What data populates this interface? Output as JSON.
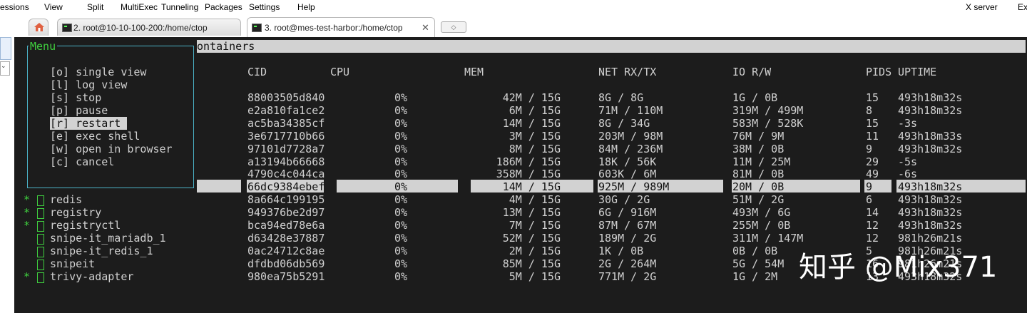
{
  "menubar": {
    "items": [
      "essions",
      "View",
      "Split",
      "MultiExec",
      "Tunneling",
      "Packages",
      "Settings",
      "Help"
    ],
    "right": [
      "X server",
      "Exi"
    ]
  },
  "tabs": [
    {
      "label": "2. root@10-10-100-200:/home/ctop",
      "active": false
    },
    {
      "label": "3. root@mes-test-harbor:/home/ctop",
      "active": true
    }
  ],
  "terminal": {
    "header_bar": "ontainers",
    "columns": [
      "CID",
      "CPU",
      "MEM",
      "NET RX/TX",
      "IO R/W",
      "PIDS",
      "UPTIME"
    ],
    "menu": {
      "title": "Menu",
      "items": [
        "[o] single view",
        "[l] log view",
        "[s] stop",
        "[p] pause",
        "restart",
        "[e] exec shell",
        "[w] open in browser",
        "[c] cancel"
      ],
      "selected_key": "[r]"
    },
    "rows": [
      {
        "name": "",
        "star": false,
        "cid": "88003505d840",
        "cpu": "0%",
        "mem": "42M / 15G",
        "net": "8G / 8G",
        "io": "1G / 0B",
        "pids": "15",
        "uptime": "493h18m32s"
      },
      {
        "name": "",
        "star": false,
        "cid": "e2a810fa1ce2",
        "cpu": "0%",
        "mem": "6M / 15G",
        "net": "71M / 110M",
        "io": "319M / 499M",
        "pids": "8",
        "uptime": "493h18m32s"
      },
      {
        "name": "",
        "star": false,
        "cid": "ac5ba34385cf",
        "cpu": "0%",
        "mem": "14M / 15G",
        "net": "8G / 34G",
        "io": "583M / 528K",
        "pids": "15",
        "uptime": "-3s"
      },
      {
        "name": "",
        "star": false,
        "cid": "3e6717710b66",
        "cpu": "0%",
        "mem": "3M / 15G",
        "net": "203M / 98M",
        "io": "76M / 9M",
        "pids": "11",
        "uptime": "493h18m33s"
      },
      {
        "name": "",
        "star": false,
        "cid": "97101d7728a7",
        "cpu": "0%",
        "mem": "8M / 15G",
        "net": "84M / 236M",
        "io": "38M / 0B",
        "pids": "9",
        "uptime": "493h18m32s"
      },
      {
        "name": "",
        "star": false,
        "cid": "a13194b66668",
        "cpu": "0%",
        "mem": "186M / 15G",
        "net": "18K / 56K",
        "io": "11M / 25M",
        "pids": "29",
        "uptime": "-5s"
      },
      {
        "name": "",
        "star": false,
        "cid": "4790c4c044ca",
        "cpu": "0%",
        "mem": "358M / 15G",
        "net": "603K / 6M",
        "io": "81M / 0B",
        "pids": "49",
        "uptime": "-6s"
      },
      {
        "name": "",
        "star": false,
        "cid": "66dc9384ebef",
        "cpu": "0%",
        "mem": "14M / 15G",
        "net": "925M / 989M",
        "io": "20M / 0B",
        "pids": "9",
        "uptime": "493h18m32s",
        "selected": true
      },
      {
        "name": "redis",
        "star": true,
        "cid": "8a664c199195",
        "cpu": "0%",
        "mem": "4M / 15G",
        "net": "30G / 2G",
        "io": "51M / 2G",
        "pids": "6",
        "uptime": "493h18m32s"
      },
      {
        "name": "registry",
        "star": true,
        "cid": "949376be2d97",
        "cpu": "0%",
        "mem": "13M / 15G",
        "net": "6G / 916M",
        "io": "493M / 6G",
        "pids": "14",
        "uptime": "493h18m32s"
      },
      {
        "name": "registryctl",
        "star": true,
        "cid": "bca94ed78e6a",
        "cpu": "0%",
        "mem": "7M / 15G",
        "net": "87M / 67M",
        "io": "255M / 0B",
        "pids": "12",
        "uptime": "493h18m32s"
      },
      {
        "name": "snipe-it_mariadb_1",
        "star": false,
        "cid": "d63428e37887",
        "cpu": "0%",
        "mem": "52M / 15G",
        "net": "189M / 2G",
        "io": "311M / 147M",
        "pids": "12",
        "uptime": "981h26m21s"
      },
      {
        "name": "snipe-it_redis_1",
        "star": false,
        "cid": "0ac24712c8ae",
        "cpu": "0%",
        "mem": "2M / 15G",
        "net": "1K / 0B",
        "io": "0B / 0B",
        "pids": "5",
        "uptime": "981h26m21s"
      },
      {
        "name": "snipeit",
        "star": false,
        "cid": "dfdbd06db569",
        "cpu": "0%",
        "mem": "85M / 15G",
        "net": "2G / 264M",
        "io": "5G / 54M",
        "pids": "16",
        "uptime": "981h26m21s"
      },
      {
        "name": "trivy-adapter",
        "star": true,
        "cid": "980ea75b5291",
        "cpu": "0%",
        "mem": "5M / 15G",
        "net": "771M / 2G",
        "io": "1G / 2M",
        "pids": "13",
        "uptime": "493h18m32s"
      }
    ]
  },
  "watermark": "知乎 @Mix371",
  "colors": {
    "terminal_bg": "#1c1c1c",
    "text": "#d0d0d0",
    "green": "#3fd03f",
    "border_cyan": "#4bb3c8",
    "highlight": "#d2d2d2"
  }
}
